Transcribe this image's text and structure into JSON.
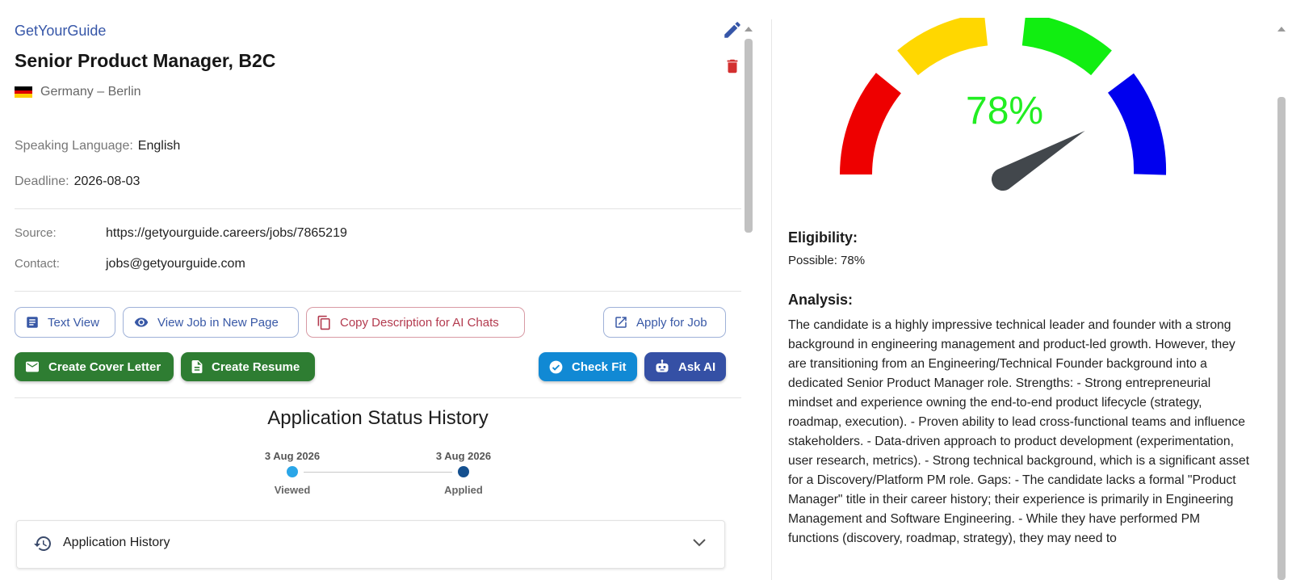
{
  "job": {
    "company": "GetYourGuide",
    "title": "Senior Product Manager, B2C",
    "location": "Germany – Berlin",
    "speaking_language_label": "Speaking Language:",
    "speaking_language": "English",
    "deadline_label": "Deadline:",
    "deadline": "2026-08-03",
    "source_label": "Source:",
    "source": "https://getyourguide.careers/jobs/7865219",
    "contact_label": "Contact:",
    "contact": "jobs@getyourguide.com"
  },
  "actions": {
    "text_view": "Text View",
    "view_new_page": "View Job in New Page",
    "copy_description": "Copy Description for AI Chats",
    "apply": "Apply for Job",
    "cover_letter": "Create Cover Letter",
    "resume": "Create Resume",
    "check_fit": "Check Fit",
    "ask_ai": "Ask AI"
  },
  "status_history": {
    "title": "Application Status History",
    "steps": [
      {
        "date": "3 Aug 2026",
        "label": "Viewed",
        "color": "#2aa6e8"
      },
      {
        "date": "3 Aug 2026",
        "label": "Applied",
        "color": "#14508f"
      }
    ]
  },
  "accordion": {
    "label": "Application History"
  },
  "fit": {
    "percent_text": "78%",
    "percent": 78,
    "colors": {
      "red": "#ee0000",
      "yellow": "#ffd700",
      "green": "#11ee11",
      "blue": "#0000ee",
      "needle": "#42474c"
    },
    "eligibility_heading": "Eligibility:",
    "eligibility_value": "Possible: 78%",
    "analysis_heading": "Analysis:",
    "analysis_text": "The candidate is a highly impressive technical leader and founder with a strong background in engineering management and product-led growth. However, they are transitioning from an Engineering/Technical Founder background into a dedicated Senior Product Manager role. Strengths: - Strong entrepreneurial mindset and experience owning the end-to-end product lifecycle (strategy, roadmap, execution). - Proven ability to lead cross-functional teams and influence stakeholders. - Data-driven approach to product development (experimentation, user research, metrics). - Strong technical background, which is a significant asset for a Discovery/Platform PM role. Gaps: - The candidate lacks a formal \"Product Manager\" title in their career history; their experience is primarily in Engineering Management and Software Engineering. - While they have performed PM functions (discovery, roadmap, strategy), they may need to"
  },
  "icons": [
    "pencil-icon",
    "trash-icon",
    "germany-flag-icon",
    "text-doc-icon",
    "eye-icon",
    "copy-icon",
    "external-link-icon",
    "mail-icon",
    "document-icon",
    "check-circle-icon",
    "robot-icon",
    "history-icon",
    "chevron-down-icon"
  ]
}
